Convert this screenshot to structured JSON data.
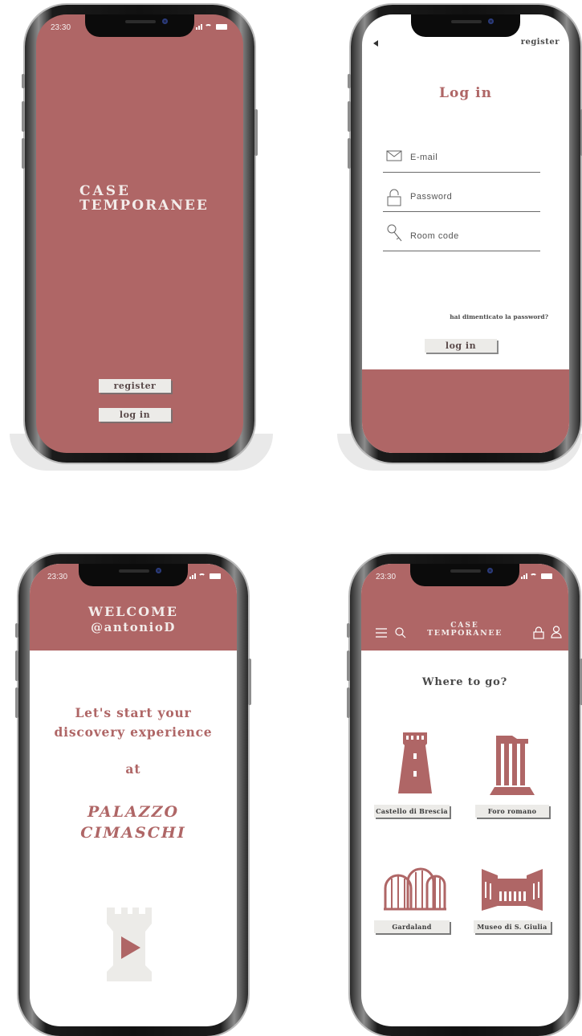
{
  "status_time": "23:30",
  "colors": {
    "accent": "#af6666",
    "button_bg": "#ecebe8",
    "text_dark": "#3a3a3a"
  },
  "splash": {
    "logo_line1": "CASE",
    "logo_line2": "TEMPORANEE",
    "register_label": "register",
    "login_label": "log in"
  },
  "login": {
    "back_icon": "back-arrow-icon",
    "register_link": "register",
    "title": "Log in",
    "email_placeholder": "E-mail",
    "password_placeholder": "Password",
    "room_code_placeholder": "Room code",
    "forgot_link": "hai dimenticato la password?",
    "login_button": "log in"
  },
  "welcome": {
    "greeting": "WELCOME",
    "username": "@antonioD",
    "line1": "Let's start your",
    "line2": "discovery experience",
    "at": "at",
    "place1": "PALAZZO",
    "place2": "CIMASCHI",
    "play_icon": "tower-play-icon"
  },
  "explore": {
    "logo_line1": "CASE",
    "logo_line2": "TEMPORANEE",
    "title": "Where to go?",
    "places": [
      {
        "label": "Castello di Brescia",
        "icon": "castle-tower-icon"
      },
      {
        "label": "Foro romano",
        "icon": "roman-ruins-icon"
      },
      {
        "label": "Gardaland",
        "icon": "roller-coaster-icon"
      },
      {
        "label": "Museo di S. Giulia",
        "icon": "museum-cloister-icon"
      }
    ]
  }
}
